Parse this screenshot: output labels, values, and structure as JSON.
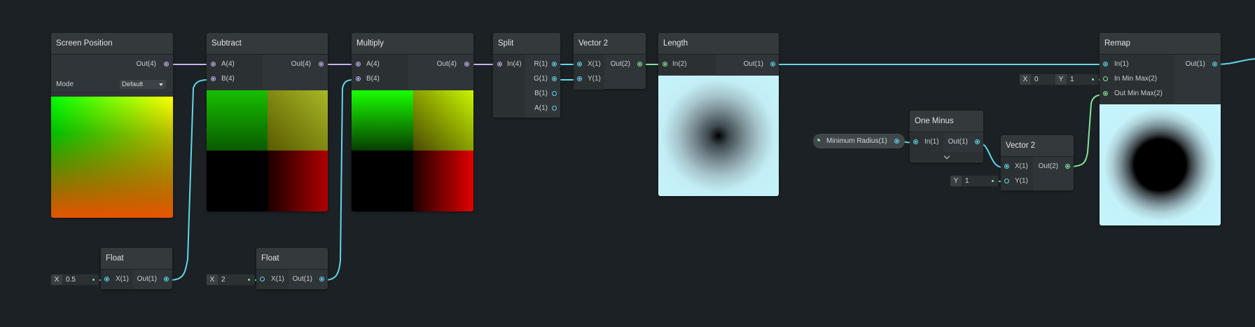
{
  "nodes": {
    "screen_position": {
      "title": "Screen Position",
      "out": "Out(4)",
      "mode_label": "Mode",
      "mode_value": "Default"
    },
    "subtract": {
      "title": "Subtract",
      "in_a": "A(4)",
      "in_b": "B(4)",
      "out": "Out(4)"
    },
    "multiply": {
      "title": "Multiply",
      "in_a": "A(4)",
      "in_b": "B(4)",
      "out": "Out(4)"
    },
    "split": {
      "title": "Split",
      "in": "In(4)",
      "out_r": "R(1)",
      "out_g": "G(1)",
      "out_b": "B(1)",
      "out_a": "A(1)"
    },
    "vector2_a": {
      "title": "Vector 2",
      "in_x": "X(1)",
      "in_y": "Y(1)",
      "out": "Out(2)"
    },
    "length": {
      "title": "Length",
      "in": "In(2)",
      "out": "Out(1)"
    },
    "float_a": {
      "title": "Float",
      "in": "X(1)",
      "out": "Out(1)",
      "field_axis": "X",
      "field_value": "0.5"
    },
    "float_b": {
      "title": "Float",
      "in": "X(1)",
      "out": "Out(1)",
      "field_axis": "X",
      "field_value": "2"
    },
    "one_minus": {
      "title": "One Minus",
      "in": "In(1)",
      "out": "Out(1)"
    },
    "vector2_b": {
      "title": "Vector 2",
      "in_x": "X(1)",
      "in_y": "Y(1)",
      "out": "Out(2)",
      "field_axis": "Y",
      "field_value": "1"
    },
    "remap": {
      "title": "Remap",
      "in": "In(1)",
      "in_min_max": "In Min Max(2)",
      "out_min_max": "Out Min Max(2)",
      "out": "Out(1)",
      "field_x_axis": "X",
      "field_x_value": "0",
      "field_y_axis": "Y",
      "field_y_value": "1"
    }
  },
  "property": {
    "label": "Minimum Radius(1)"
  },
  "colors": {
    "background": "#1b2124",
    "node": "#2f3538",
    "wire_float": "#62d6e8",
    "wire_vector2": "#84e39a",
    "wire_vector4": "#c3b4ef"
  }
}
